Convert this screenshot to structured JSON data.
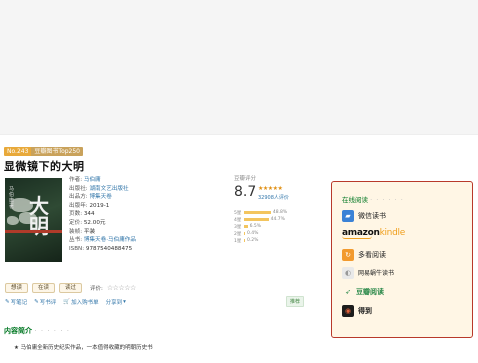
{
  "book": {
    "rank_no": "No.243",
    "rank_label": "豆瓣图书Top250",
    "title": "显微镜下的大明",
    "cover": {
      "big_char": "大明",
      "vertical_text": "马伯庸著"
    }
  },
  "info": [
    {
      "k": "作者: ",
      "v": "马伯庸",
      "link": true
    },
    {
      "k": "出版社: ",
      "v": "湖南文艺出版社",
      "link": true
    },
    {
      "k": "出品方: ",
      "v": "博集天卷",
      "link": true
    },
    {
      "k": "出版年: ",
      "v": "2019-1",
      "link": false
    },
    {
      "k": "页数: ",
      "v": "344",
      "link": false
    },
    {
      "k": "定价: ",
      "v": "52.00元",
      "link": false
    },
    {
      "k": "装帧: ",
      "v": "平装",
      "link": false
    },
    {
      "k": "丛书: ",
      "v": "博集天卷·马伯庸作品",
      "link": true
    },
    {
      "k": "ISBN: ",
      "v": "9787540488475",
      "link": false
    }
  ],
  "rating": {
    "label": "豆瓣评分",
    "score": "8.7",
    "stars": "★★★★★",
    "count": "32908人评价",
    "breakdown": [
      {
        "label": "5星",
        "pct": "48.8%",
        "value": 48.8
      },
      {
        "label": "4星",
        "pct": "44.7%",
        "value": 44.7
      },
      {
        "label": "3星",
        "pct": "6.5%",
        "value": 6.5
      },
      {
        "label": "2星",
        "pct": "0.4%",
        "value": 0.4
      },
      {
        "label": "1星",
        "pct": "0.2%",
        "value": 0.2
      }
    ]
  },
  "actions": {
    "want": "想读",
    "reading": "在读",
    "read": "读过",
    "rate_label": "评价:",
    "rate_stars": "☆☆☆☆☆"
  },
  "ops": {
    "note": "写笔记",
    "review": "写书评",
    "add_list": "加入购书单",
    "share": "分享到"
  },
  "recommend": "推荐",
  "intro": {
    "title": "内容简介",
    "dots": "· · · · · ·",
    "text": "★ 马伯庸全新历史纪实作品，一本值得收藏的明朝历史书"
  },
  "online": {
    "title": "在线阅读",
    "dots": "· · · · · ·",
    "vendors": {
      "weixin": "微信读书",
      "amazon_a": "amazon",
      "amazon_k": "kindle",
      "duokan": "多看阅读",
      "netease": "网易蜗牛读书",
      "douban": "豆瓣阅读",
      "dedao": "得到"
    }
  },
  "colors": {
    "accent_green": "#007722",
    "link_blue": "#3377aa",
    "panel_border": "#b8392a",
    "panel_bg": "#fff6e5",
    "star": "#e09015"
  }
}
